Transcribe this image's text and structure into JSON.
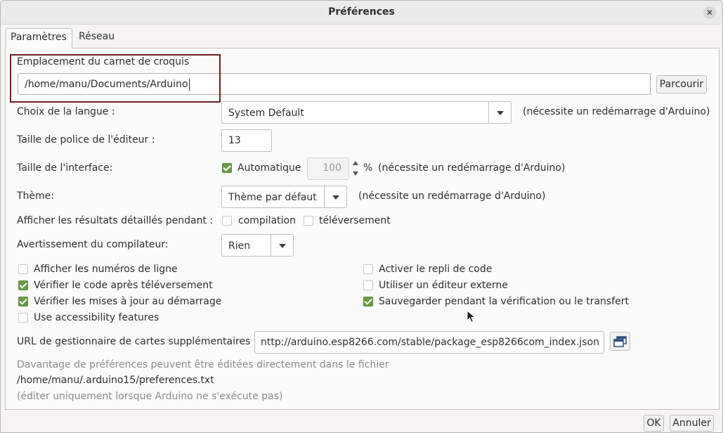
{
  "window": {
    "title": "Préférences"
  },
  "tabs": [
    {
      "label": "Paramètres",
      "active": true
    },
    {
      "label": "Réseau",
      "active": false
    }
  ],
  "sketchbook": {
    "label": "Emplacement du carnet de croquis",
    "path": "/home/manu/Documents/Arduino",
    "browse_label": "Parcourir"
  },
  "language": {
    "label": "Choix de la langue :",
    "selected": "System Default",
    "note": "(nécessite un redémarrage d'Arduino)"
  },
  "editor_font": {
    "label": "Taille de police de l'éditeur :",
    "value": "13"
  },
  "interface_scale": {
    "label": "Taille de l'interface:",
    "auto_label": "Automatique",
    "auto_checked": true,
    "value": "100",
    "unit": "%",
    "note": "(nécessite un redémarrage d'Arduino)"
  },
  "theme": {
    "label": "Thème:",
    "selected": "Thème par défaut",
    "note": "(nécessite un redémarrage d'Arduino)"
  },
  "verbose": {
    "label": "Afficher les résultats détaillés pendant :",
    "compile_label": "compilation",
    "compile_checked": false,
    "upload_label": "téléversement",
    "upload_checked": false
  },
  "compiler_warnings": {
    "label": "Avertissement du compilateur:",
    "selected": "Rien"
  },
  "options_left": [
    {
      "label": "Afficher les numéros de ligne",
      "checked": false
    },
    {
      "label": "Vérifier le code après téléversement",
      "checked": true
    },
    {
      "label": "Vérifier les mises à jour au démarrage",
      "checked": true
    },
    {
      "label": "Use accessibility features",
      "checked": false
    }
  ],
  "options_right": [
    {
      "label": "Activer le repli de code",
      "checked": false
    },
    {
      "label": "Utiliser un éditeur externe",
      "checked": false
    },
    {
      "label": "Sauvegarder pendant la vérification ou le transfert",
      "checked": true
    }
  ],
  "boards_url": {
    "label": "URL de gestionnaire de cartes supplémentaires",
    "value": "nttp://arduino.esp8266.com/stable/package_esp8266com_index.json",
    "icon": "window-stack-icon"
  },
  "footer": {
    "info": "Davantage de préférences peuvent être éditées directement dans le fichier",
    "path": "/home/manu/.arduino15/preferences.txt",
    "note": "(éditer uniquement lorsque Arduino ne s'exécute pas)"
  },
  "buttons": {
    "ok": "OK",
    "cancel": "Annuler"
  }
}
